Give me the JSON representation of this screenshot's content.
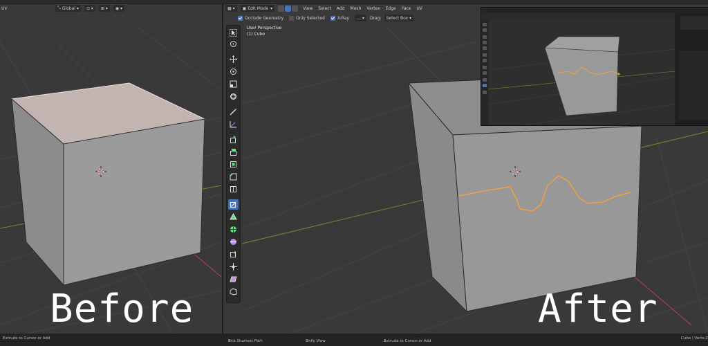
{
  "left_header": {
    "mode_label": "UV",
    "orientation": "Global"
  },
  "center_header": {
    "mode": "Edit Mode",
    "menus": [
      "View",
      "Select",
      "Add",
      "Mesh",
      "Vertex",
      "Edge",
      "Face",
      "UV"
    ]
  },
  "tool_header": {
    "occlude_geometry": "Occlude Geometry",
    "only_selected": "Only Selected",
    "xray": "X-Ray",
    "drag_label": "Drag:",
    "drag_value": "Select Box"
  },
  "viewport_info": {
    "perspective": "User Perspective",
    "object": "(1) Cube"
  },
  "labels": {
    "before": "Before",
    "after": "After"
  },
  "status_bar": {
    "left": "Extrude to Cursor or Add",
    "pick": "Pick Shortest Path",
    "dolly": "Dolly View",
    "extrude": "Extrude to Cursor or Add",
    "right": "Cube | Verts:2"
  },
  "colors": {
    "accent": "#4772b3",
    "path": "#f0a040",
    "axis_x": "#c04050",
    "axis_y": "#7aa03a"
  }
}
